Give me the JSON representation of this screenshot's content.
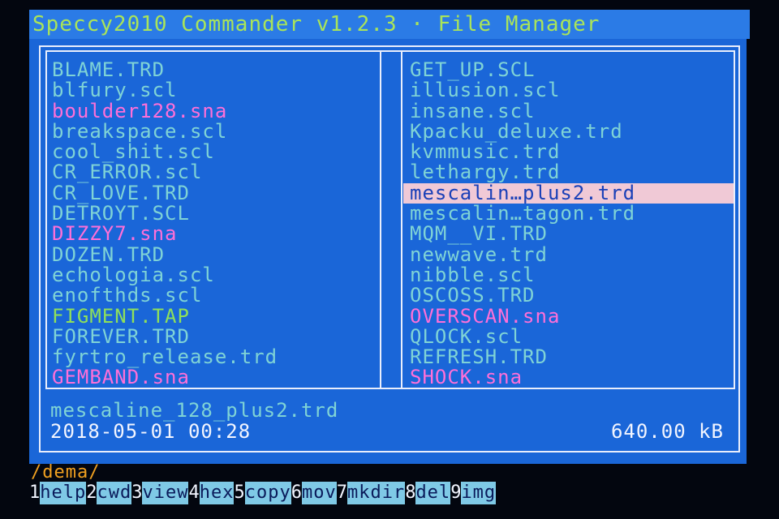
{
  "title": "Speccy2010 Commander v1.2.3 · File Manager",
  "left_panel": {
    "files": [
      {
        "name": "BLAME.TRD",
        "type": "default"
      },
      {
        "name": "blfury.scl",
        "type": "default"
      },
      {
        "name": "boulder128.sna",
        "type": "sna"
      },
      {
        "name": "breakspace.scl",
        "type": "default"
      },
      {
        "name": "cool_shit.scl",
        "type": "default"
      },
      {
        "name": "CR_ERROR.scl",
        "type": "default"
      },
      {
        "name": "CR_LOVE.TRD",
        "type": "default"
      },
      {
        "name": "DETROYT.SCL",
        "type": "default"
      },
      {
        "name": "DIZZY7.sna",
        "type": "sna"
      },
      {
        "name": "DOZEN.TRD",
        "type": "default"
      },
      {
        "name": "echologia.scl",
        "type": "default"
      },
      {
        "name": "enofthds.scl",
        "type": "default"
      },
      {
        "name": "FIGMENT.TAP",
        "type": "tap"
      },
      {
        "name": "FOREVER.TRD",
        "type": "default"
      },
      {
        "name": "fyrtro_release.trd",
        "type": "default"
      },
      {
        "name": "GEMBAND.sna",
        "type": "sna"
      }
    ]
  },
  "right_panel": {
    "files": [
      {
        "name": "GET_UP.SCL",
        "type": "default"
      },
      {
        "name": "illusion.scl",
        "type": "default"
      },
      {
        "name": "insane.scl",
        "type": "default"
      },
      {
        "name": "Kpacku_deluxe.trd",
        "type": "default"
      },
      {
        "name": "kvmmusic.trd",
        "type": "default"
      },
      {
        "name": "lethargy.trd",
        "type": "default"
      },
      {
        "name": "mescalin…plus2.trd",
        "type": "selected"
      },
      {
        "name": "mescalin…tagon.trd",
        "type": "default"
      },
      {
        "name": "MQM__VI.TRD",
        "type": "default"
      },
      {
        "name": "newwave.trd",
        "type": "default"
      },
      {
        "name": "nibble.scl",
        "type": "default"
      },
      {
        "name": "OSCOSS.TRD",
        "type": "default"
      },
      {
        "name": "OVERSCAN.sna",
        "type": "sna"
      },
      {
        "name": "QLOCK.scl",
        "type": "default"
      },
      {
        "name": "REFRESH.TRD",
        "type": "default"
      },
      {
        "name": "SHOCK.sna",
        "type": "sna"
      }
    ]
  },
  "info": {
    "filename": "mescaline_128_plus2.trd",
    "datetime": "2018-05-01 00:28",
    "size": "640.00 kB"
  },
  "path": "/dema/",
  "function_keys": [
    {
      "num": "1",
      "label": "help"
    },
    {
      "num": "2",
      "label": "cwd"
    },
    {
      "num": "3",
      "label": "view"
    },
    {
      "num": "4",
      "label": "hex"
    },
    {
      "num": "5",
      "label": "copy"
    },
    {
      "num": "6",
      "label": "mov"
    },
    {
      "num": "7",
      "label": "mkdir"
    },
    {
      "num": "8",
      "label": "del"
    },
    {
      "num": "9",
      "label": "img"
    }
  ],
  "colors": {
    "background": "#1a66d8",
    "title_bar": "#2b7be6",
    "title_text": "#a9e45a",
    "default_file": "#7fd3d6",
    "sna_file": "#ff6fd8",
    "tap_file": "#8fe05a",
    "selection_bg": "#f0c9d6",
    "path_text": "#f0a020"
  }
}
